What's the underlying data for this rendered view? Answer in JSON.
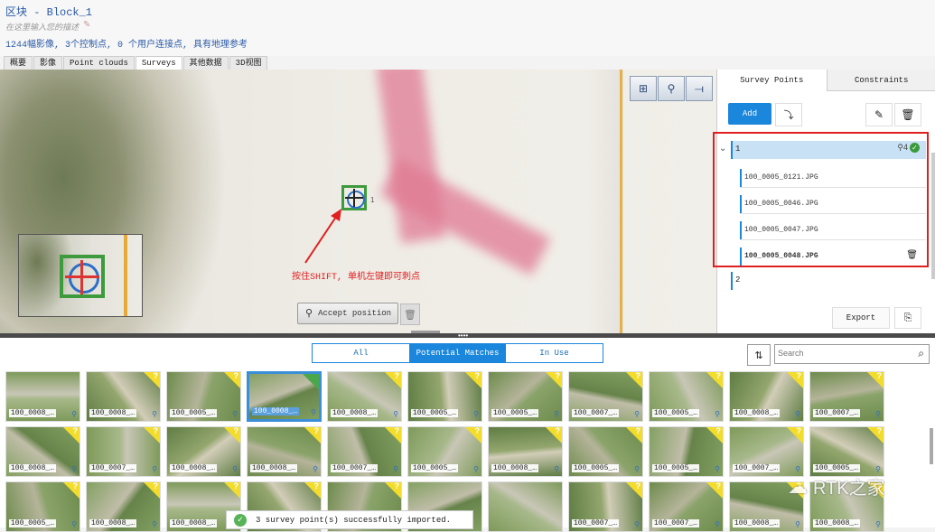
{
  "header": {
    "title": "区块 - Block_1",
    "description_placeholder": "在这里输入您的描述",
    "stats": "1244幅影像, 3个控制点, 0 个用户连接点, 具有地理参考"
  },
  "tabs": [
    {
      "label": "概要"
    },
    {
      "label": "影像"
    },
    {
      "label": "Point clouds"
    },
    {
      "label": "Surveys"
    },
    {
      "label": "其他数据"
    },
    {
      "label": "3D视图"
    }
  ],
  "active_tab": "Surveys",
  "map": {
    "target_label": "1",
    "annotation": "按住SHIFT, 单机左键即可刺点",
    "accept_label": "Accept position"
  },
  "right_panel": {
    "tabs": [
      {
        "label": "Survey Points"
      },
      {
        "label": "Constraints"
      }
    ],
    "add_label": "Add",
    "points": [
      {
        "name": "1",
        "count": "4",
        "expanded": true,
        "images": [
          "100_0005_0121.JPG",
          "100_0005_0046.JPG",
          "100_0005_0047.JPG",
          "100_0005_0048.JPG"
        ]
      },
      {
        "name": "2"
      }
    ],
    "export_label": "Export"
  },
  "bottom": {
    "filters": [
      {
        "label": "All"
      },
      {
        "label": "Potential Matches"
      },
      {
        "label": "In Use"
      }
    ],
    "active_filter": "Potential Matches",
    "search_placeholder": "Search",
    "toast": "3 survey point(s) successfully imported.",
    "thumbnails": [
      [
        "100_0008_…",
        "100_0008_…",
        "100_0005_…",
        "100_0008_…",
        "100_0008_…",
        "100_0005_…",
        "100_0005_…",
        "100_0007_…",
        "100_0005_…",
        "100_0008_…",
        "100_0007_…"
      ],
      [
        "100_0008_…",
        "100_0007_…",
        "100_0008_…",
        "100_0008_…",
        "100_0007_…",
        "100_0005_…",
        "100_0008_…",
        "100_0005_…",
        "100_0005_…",
        "100_0007_…",
        "100_0005_…"
      ],
      [
        "100_0005_…",
        "100_0008_…",
        "100_0008_…",
        "",
        "",
        "",
        "",
        "100_0007_…",
        "100_0007_…",
        "100_0008_…",
        "100_0008_…"
      ]
    ]
  },
  "watermark": "RTK之家",
  "colors": {
    "accent": "#1a86dc",
    "annotation": "#e02020",
    "ok": "#3a9a3a",
    "unknown_badge": "#f4dd2a"
  }
}
